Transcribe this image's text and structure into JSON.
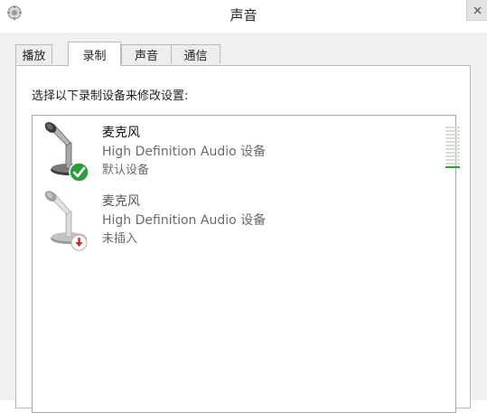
{
  "window": {
    "title": "声音",
    "app_icon": "speaker-settings-icon",
    "close_icon": "close-icon"
  },
  "tabs": [
    {
      "label": "播放",
      "active": false
    },
    {
      "label": "录制",
      "active": true
    },
    {
      "label": "声音",
      "active": false
    },
    {
      "label": "通信",
      "active": false
    }
  ],
  "recording": {
    "instruction": "选择以下录制设备来修改设置:",
    "devices": [
      {
        "name": "麦克风",
        "description": "High Definition Audio 设备",
        "status": "默认设备",
        "icon": "microphone-icon",
        "badge": "checkmark-icon",
        "badge_color": "#2e9e3c",
        "level": 0.1
      },
      {
        "name": "麦克风",
        "description": "High Definition Audio 设备",
        "status": "未插入",
        "icon": "microphone-icon",
        "badge": "unplugged-icon",
        "badge_color": "#c62828"
      }
    ]
  },
  "colors": {
    "level_active": "#3a9a3a",
    "level_inactive": "#d4e0d4"
  }
}
